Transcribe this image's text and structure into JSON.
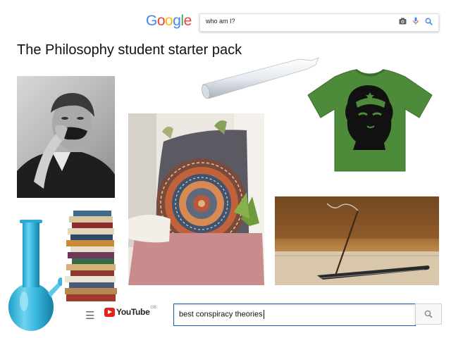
{
  "google": {
    "logo_letters": [
      {
        "char": "G",
        "color": "#4285f4"
      },
      {
        "char": "o",
        "color": "#ea4335"
      },
      {
        "char": "o",
        "color": "#fbbc05"
      },
      {
        "char": "g",
        "color": "#4285f4"
      },
      {
        "char": "l",
        "color": "#34a853"
      },
      {
        "char": "e",
        "color": "#ea4335"
      }
    ],
    "search_query": "who am I?",
    "icons": [
      "camera-icon",
      "microphone-icon",
      "search-icon"
    ]
  },
  "title": "The Philosophy student starter pack",
  "images": [
    "nietzsche-portrait",
    "rolled-joint",
    "che-guevara-tshirt",
    "mandala-tapestry",
    "incense-stick",
    "glass-bong",
    "book-stack"
  ],
  "youtube": {
    "logo_text": "YouTube",
    "region": "GB",
    "search_query": "best conspiracy theories",
    "icons": [
      "hamburger-menu-icon",
      "search-icon"
    ]
  },
  "colors": {
    "tshirt_green": "#4d8a3a",
    "bong_blue": "#3ab8e0",
    "youtube_red": "#e62117",
    "focus_blue": "#1c62b9"
  }
}
